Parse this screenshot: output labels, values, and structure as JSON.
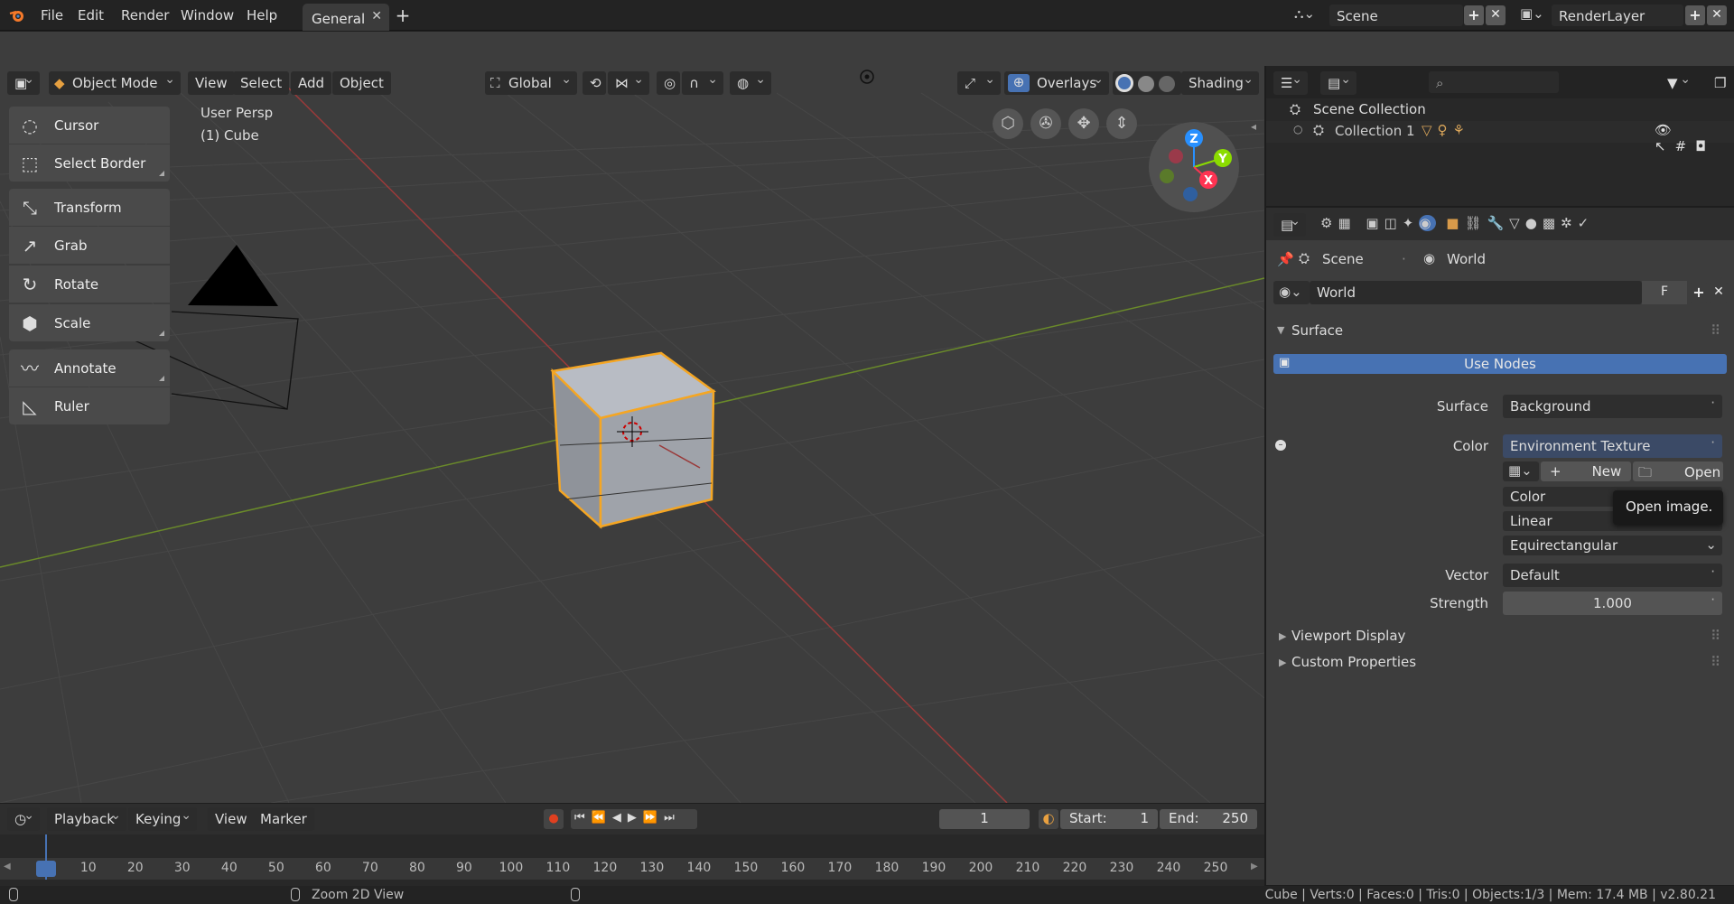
{
  "menubar": {
    "items": [
      "File",
      "Edit",
      "Render",
      "Window",
      "Help"
    ],
    "workspace_tab": "General",
    "scene": "Scene",
    "render_layer": "RenderLayer"
  },
  "viewport": {
    "mode": "Object Mode",
    "menu": [
      "View",
      "Select",
      "Add",
      "Object"
    ],
    "orientation": "Global",
    "overlays": "Overlays",
    "shading": "Shading",
    "info_line1": "User Persp",
    "info_line2": "(1) Cube",
    "tools": [
      "Cursor",
      "Select Border",
      "Transform",
      "Grab",
      "Rotate",
      "Scale",
      "Annotate",
      "Ruler"
    ],
    "gizmo": {
      "z": "Z",
      "y": "Y",
      "x": "X"
    }
  },
  "outliner": {
    "root": "Scene Collection",
    "collection": "Collection 1"
  },
  "properties": {
    "breadcrumb_scene": "Scene",
    "breadcrumb_world": "World",
    "world_name": "World",
    "fake_user": "F",
    "panel_surface": "Surface",
    "use_nodes": "Use Nodes",
    "surface_label": "Surface",
    "surface_value": "Background",
    "color_label": "Color",
    "color_value": "Environment Texture",
    "new_label": "New",
    "open_label": "Open",
    "colorspace": "Color",
    "interp": "Linear",
    "projection": "Equirectangular",
    "tooltip": "Open image.",
    "vector_label": "Vector",
    "vector_value": "Default",
    "strength_label": "Strength",
    "strength_value": "1.000",
    "panel_viewport_display": "Viewport Display",
    "panel_custom_props": "Custom Properties"
  },
  "timeline": {
    "menu": [
      "Playback",
      "Keying",
      "View",
      "Marker"
    ],
    "current_frame": "1",
    "start_label": "Start:",
    "start_value": "1",
    "end_label": "End:",
    "end_value": "250",
    "ticks": [
      "1",
      "10",
      "20",
      "30",
      "40",
      "50",
      "60",
      "70",
      "80",
      "90",
      "100",
      "110",
      "120",
      "130",
      "140",
      "150",
      "160",
      "170",
      "180",
      "190",
      "200",
      "210",
      "220",
      "230",
      "240",
      "250"
    ]
  },
  "status": {
    "hint": "Zoom 2D View",
    "stats": "Cube | Verts:0 | Faces:0 | Tris:0 | Objects:1/3 | Mem: 17.4 MB | v2.80.21"
  },
  "colors": {
    "accent_blue": "#4772b3",
    "select_orange": "#f5a623",
    "x_axis": "#ff3352",
    "y_axis": "#8bdc00",
    "z_axis": "#2890ff"
  }
}
